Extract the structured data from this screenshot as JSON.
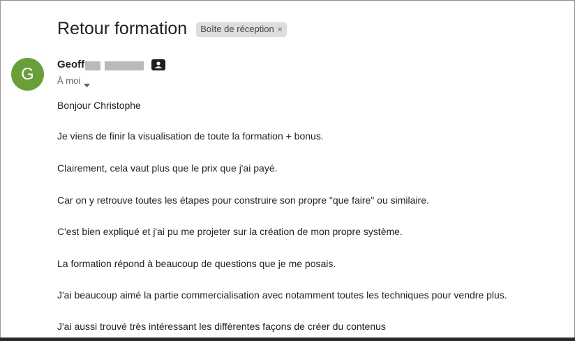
{
  "email": {
    "subject": "Retour formation",
    "label_chip": "Boîte de réception",
    "label_close": "×",
    "avatar_letter": "G",
    "sender_name": "Geoff",
    "recipient": "À moi",
    "body_lines": [
      "Bonjour Christophe",
      "Je viens de finir la visualisation de toute la formation + bonus.",
      "Clairement, cela vaut plus que le prix que j'ai payé.",
      "Car on y retrouve toutes les étapes pour construire son propre \"que faire\" ou similaire.",
      "C'est bien expliqué et j'ai pu me projeter sur la création de mon propre système.",
      "La formation répond à beaucoup de questions que je me posais.",
      "J'ai beaucoup aimé la partie commercialisation avec notamment toutes les techniques pour vendre plus.",
      "J'ai aussi trouvé très intéressant les différentes façons de créer du contenus"
    ]
  },
  "colors": {
    "avatar_bg": "#689f38",
    "chip_bg": "#dddddd",
    "redaction": "#b9b9b9"
  },
  "icons": {
    "contact": "contact-card-icon",
    "dropdown": "chevron-down-icon"
  }
}
